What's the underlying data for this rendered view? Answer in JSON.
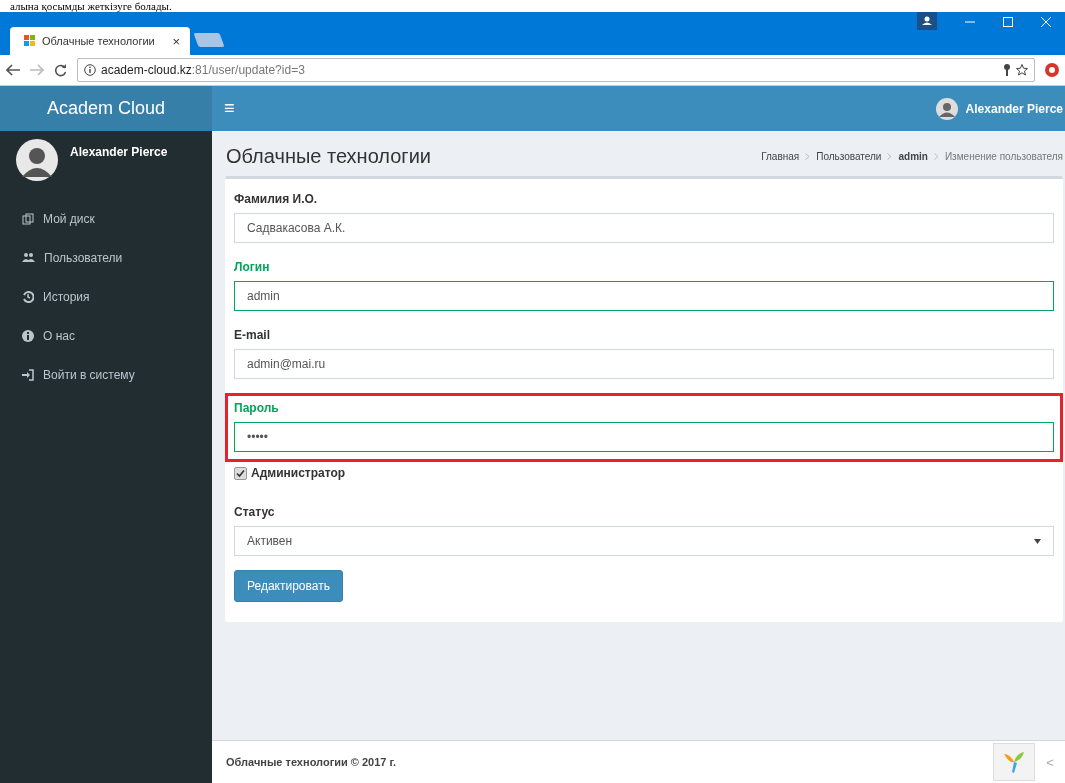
{
  "document_caption": "алына қосымды жеткізуге болады.",
  "browser": {
    "tabs": [
      {
        "title": "Облачные технологии",
        "close": "×",
        "selected": true
      },
      {
        "selected": false
      }
    ],
    "url_host": "academ-cloud.kz",
    "url_path": ":81/user/update?id=3"
  },
  "header": {
    "logo": "Academ Cloud",
    "menu_toggle": "≡",
    "user": "Alexander Pierce"
  },
  "sidebar": {
    "user": "Alexander Pierce",
    "items": [
      {
        "label": "Мой диск"
      },
      {
        "label": "Пользователи"
      },
      {
        "label": "История"
      },
      {
        "label": "О нас"
      },
      {
        "label": "Войти в систему"
      }
    ]
  },
  "page_title": "Облачные технологии",
  "breadcrumbs": [
    {
      "label": "Главная",
      "current": false,
      "bold": false
    },
    {
      "label": "Пользователи",
      "current": false,
      "bold": false
    },
    {
      "label": "admin",
      "current": false,
      "bold": true
    },
    {
      "label": "Изменение пользователя",
      "current": true,
      "bold": false
    }
  ],
  "form": {
    "fields": [
      {
        "label": "Фамилия И.О.",
        "value": "Садвакасова А.К.",
        "valid": false,
        "highlighted": false
      },
      {
        "label": "Логин",
        "value": "admin",
        "valid": true,
        "highlighted": false
      },
      {
        "label": "E-mail",
        "value": "admin@mai.ru",
        "valid": false,
        "highlighted": false
      },
      {
        "label": "Пароль",
        "value": "•••••",
        "valid": true,
        "highlighted": true
      }
    ],
    "checkbox": {
      "label": "Администратор",
      "checked": true
    },
    "status": {
      "label": "Статус",
      "value": "Активен"
    },
    "submit": "Редактировать"
  },
  "footer": {
    "text": "Облачные технологии © 2017 г.",
    "arrow": "<"
  }
}
